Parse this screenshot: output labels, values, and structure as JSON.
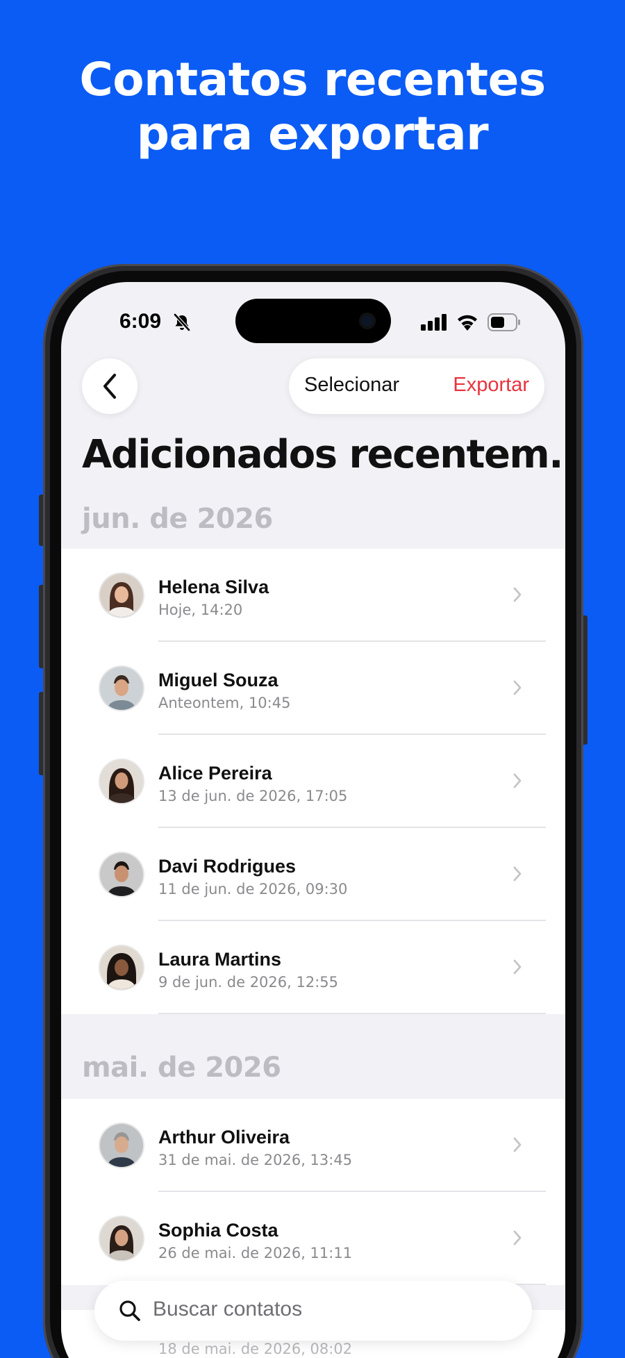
{
  "headline": [
    "Contatos recentes",
    "para exportar"
  ],
  "status_bar": {
    "time": "6:09"
  },
  "nav": {
    "select_label": "Selecionar",
    "export_label": "Exportar"
  },
  "page_title": "Adicionados recentem...",
  "sections": [
    {
      "header": "jun. de 2026",
      "contacts": [
        {
          "name": "Helena Silva",
          "date": "Hoje, 14:20"
        },
        {
          "name": "Miguel Souza",
          "date": "Anteontem, 10:45"
        },
        {
          "name": "Alice Pereira",
          "date": "13 de jun. de 2026, 17:05"
        },
        {
          "name": "Davi Rodrigues",
          "date": "11 de jun. de 2026, 09:30"
        },
        {
          "name": "Laura Martins",
          "date": "9 de jun. de 2026, 12:55"
        }
      ]
    },
    {
      "header": "mai. de 2026",
      "contacts": [
        {
          "name": "Arthur Oliveira",
          "date": "31 de mai. de 2026, 13:45"
        },
        {
          "name": "Sophia Costa",
          "date": "26 de mai. de 2026, 11:11"
        }
      ]
    }
  ],
  "peek_row": {
    "date": "18 de mai. de 2026, 08:02"
  },
  "search": {
    "placeholder": "Buscar contatos"
  },
  "colors": {
    "background": "#0b5cf5",
    "accent_red": "#e8343f"
  }
}
